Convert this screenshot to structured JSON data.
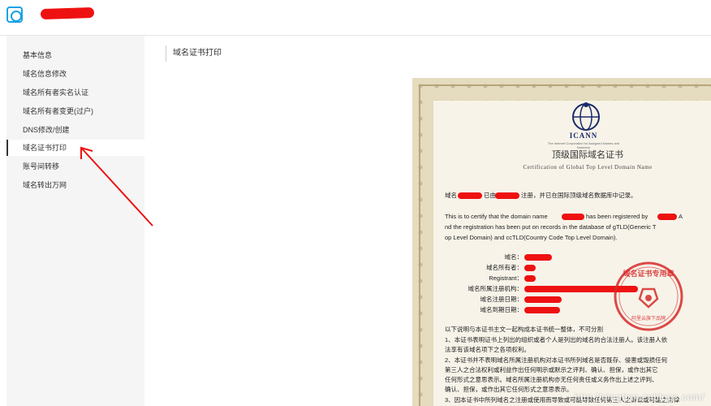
{
  "sidebar": {
    "items": [
      {
        "label": "基本信息"
      },
      {
        "label": "域名信息修改"
      },
      {
        "label": "域名所有者实名认证"
      },
      {
        "label": "域名所有者变更(过户)"
      },
      {
        "label": "DNS修改/创建"
      },
      {
        "label": "域名证书打印"
      },
      {
        "label": "账号间转移"
      },
      {
        "label": "域名转出万网"
      }
    ],
    "active_index": 5
  },
  "main": {
    "title": "域名证书打印"
  },
  "certificate": {
    "brand": "ICANN",
    "brand_sub": "The Internet Corporation for Assigned Names and Numbers",
    "title_zh": "顶级国际域名证书",
    "title_en": "Certification of Global Top Level Domain Name",
    "intro_zh_a": "域名",
    "intro_zh_b": "已由",
    "intro_zh_c": "注册，并已在国际顶级域名数据库中记录。",
    "intro_en_1a": "This is to certify that the domain name",
    "intro_en_1b": "has been registered by",
    "intro_en_1c": "A",
    "intro_en_2": "nd the registration has been put on records in the database of gTLD(Generic T",
    "intro_en_3": "op Level Domain) and ccTLD(Country Code Top Level Domain).",
    "fields": [
      {
        "label": "域名："
      },
      {
        "label": "域名所有者："
      },
      {
        "label": "Registrant："
      },
      {
        "label": "域名所属注册机构："
      },
      {
        "label": "域名注册日期："
      },
      {
        "label": "域名到期日期："
      }
    ],
    "notes_title": "以下说明与本证书主文一起构成本证书统一整体，不可分割",
    "notes": [
      "1、本证书表明证书上列出的组织或者个人是列出的域名的合法注册人。该注册人依",
      "    法享有该域名项下之各项权利。",
      "2、本证书并不表明域名所属注册机构对本证书所列域名是否既存、侵害或毁损任何",
      "    第三人之合法权利或利益作出任何明示或默示之评判、确认、担保，或作出其它",
      "    任何形式之意思表示。域名所属注册机构亦无任何责任或义务作出上述之评判、",
      "    确认、担保，或作出其它任何形式之意思表示。",
      "3、因本证书中所列域名之注册或使用而导致或可能导致任何第三人之诉讼或可能之法律"
    ],
    "stamp_text": "域名证书专用章",
    "stamp_sub": "阿里云旗下品牌"
  },
  "watermark": "http://qingtian.cnblogs.com/",
  "colors": {
    "redaction": "#ee1111",
    "stamp": "#d62a2a",
    "logo_blue": "#1aa1e6",
    "cert_bg": "#f7f3e9",
    "cert_border": "#e5dbbe"
  }
}
